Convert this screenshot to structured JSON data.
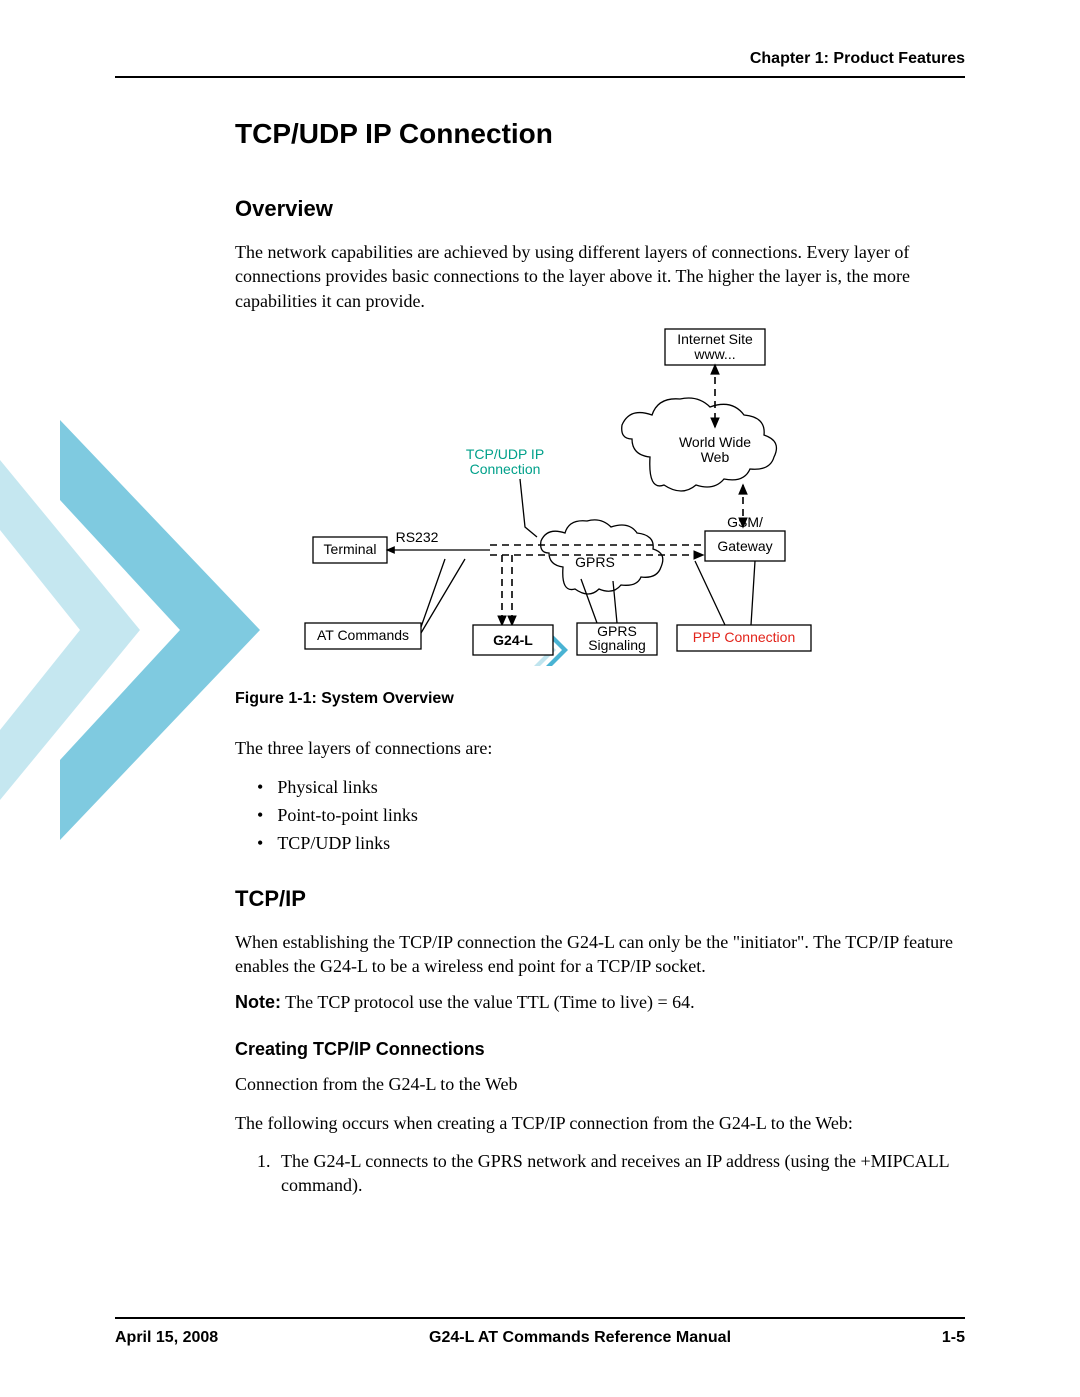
{
  "header": {
    "chapter": "Chapter 1:  Product Features"
  },
  "main": {
    "title": "TCP/UDP IP Connection",
    "overview": {
      "heading": "Overview",
      "para": "The network capabilities are achieved by using different layers of connections. Every layer of connections provides basic connections to the layer above it. The higher the layer is, the more capabilities it can provide."
    },
    "figure": {
      "caption": "Figure 1-1: System Overview",
      "labels": {
        "internet_l1": "Internet Site",
        "internet_l2": "www...",
        "www_l1": "World Wide",
        "www_l2": "Web",
        "tcpudp_l1": "TCP/UDP IP",
        "tcpudp_l2": "Connection",
        "terminal": "Terminal",
        "rs232": "RS232",
        "gprs": "GPRS",
        "gsm_l1": "GSM/",
        "gsm_l2": "Gateway",
        "at": "AT Commands",
        "g24l": "G24-L",
        "gprs_sig_l1": "GPRS",
        "gprs_sig_l2": "Signaling",
        "ppp": "PPP Connection"
      }
    },
    "layers_intro": "The three layers of connections are:",
    "layers": {
      "a": "Physical links",
      "b": "Point-to-point links",
      "c": "TCP/UDP links"
    },
    "tcpip": {
      "heading": "TCP/IP",
      "para": "When establishing the TCP/IP connection the G24-L can only be the \"initiator\". The TCP/IP feature enables the G24-L to be a wireless end point for a TCP/IP socket.",
      "note_label": "Note:",
      "note_text": "  The TCP protocol use the value TTL (Time to live) = 64."
    },
    "creating": {
      "heading": "Creating TCP/IP Connections",
      "line1": "Connection from the G24-L to the Web",
      "line2": "The following occurs when creating a TCP/IP connection from the G24-L to the Web:",
      "step1": "The G24-L connects to the GPRS network and receives an IP address (using the +MIPCALL command)."
    }
  },
  "footer": {
    "date": "April 15, 2008",
    "manual": "G24-L AT Commands Reference Manual",
    "page": "1-5"
  }
}
